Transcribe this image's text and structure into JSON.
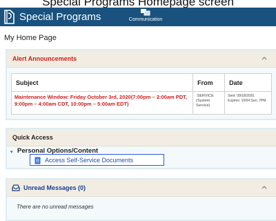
{
  "caption": "Special Programs Homepage screen",
  "app": {
    "title": "Special Programs",
    "logo_icon": "document-logo-icon"
  },
  "nav": {
    "communication_label": "Communication",
    "communication_icon": "chat-bubbles-icon"
  },
  "page_title": "My Home Page",
  "alerts": {
    "title": "Alert Announcements",
    "headers": {
      "subject": "Subject",
      "from": "From",
      "date": "Date"
    },
    "rows": [
      {
        "subject": "Maintenance Window: Friday October 3rd, 2020(7:00pm – 2:00am PDT, 9:00pm – 4:00am CDT, 10:00pm – 5:00am EDT)",
        "from": ":SERVICE (System Service)",
        "date": "Sent: 09/18/2020, Expires: 10/04 Sun, 7PM"
      }
    ]
  },
  "quick_access": {
    "title": "Quick Access",
    "group_label": "Personal Options/Content",
    "link_label": "Access Self-Service Documents"
  },
  "messages": {
    "title": "Unread Messages (0)",
    "empty_text": "There are no unread messages"
  },
  "colors": {
    "topbar": "#19527f",
    "alert_red": "#d11c1c",
    "link_blue": "#1f4ea8",
    "panel_head": "#f1ede3"
  }
}
